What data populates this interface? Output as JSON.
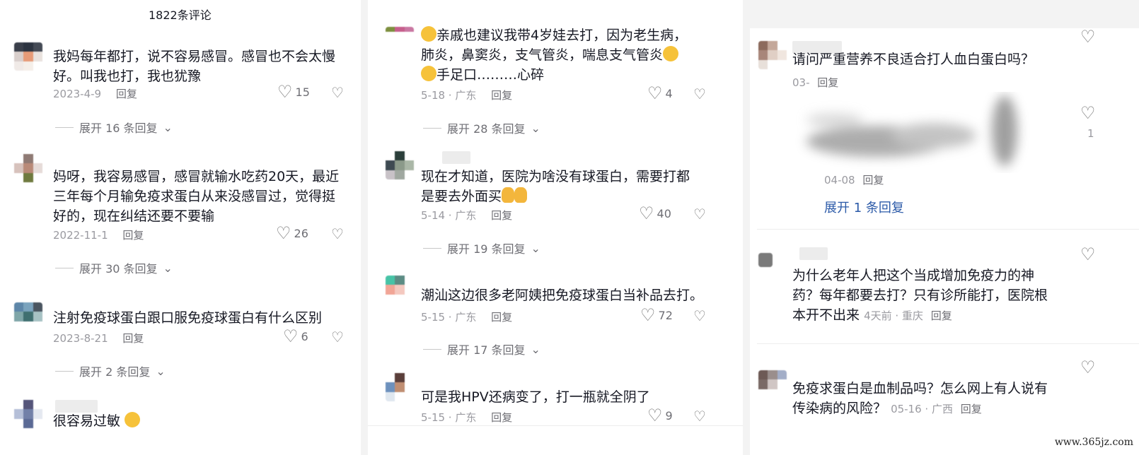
{
  "col1": {
    "header": "1822条评论",
    "comments": [
      {
        "text": "我妈每年都打，说不容易感冒。感冒也不会太慢好。叫我也打，我也犹豫",
        "date": "2023-4-9",
        "reply": "回复",
        "likes": "15",
        "expand": "展开 16 条回复"
      },
      {
        "text": "妈呀，我容易感冒，感冒就输水吃药20天，最近三年每个月输免疫求蛋白从来没感冒过，觉得挺好的，现在纠结还要不要输",
        "date": "2022-11-1",
        "reply": "回复",
        "likes": "26",
        "expand": "展开 30 条回复"
      },
      {
        "text": "注射免疫球蛋白跟口服免疫球蛋白有什么区别",
        "date": "2023-8-21",
        "reply": "回复",
        "likes": "6",
        "expand": "展开 2 条回复"
      },
      {
        "text": "很容易过敏"
      }
    ]
  },
  "col2": {
    "comments": [
      {
        "text_a": "亲戚也建议我带4岁娃去打，因为老生病，",
        "text_b": "肺炎，鼻窦炎，支气管炎，喘息支气管炎",
        "text_c": "手足口………心碎",
        "date": "5-18 · 广东",
        "reply": "回复",
        "likes": "4",
        "expand": "展开 28 条回复"
      },
      {
        "text_a": "现在才知道，医院为啥没有球蛋白，需要打都",
        "text_b": "是要去外面买",
        "date": "5-14 · 广东",
        "reply": "回复",
        "likes": "40",
        "expand": "展开 19 条回复"
      },
      {
        "text": "潮汕这边很多老阿姨把免疫球蛋白当补品去打。",
        "date": "5-15 · 广东",
        "reply": "回复",
        "likes": "72",
        "expand": "展开 17 条回复"
      },
      {
        "text": "可是我HPV还病变了，打一瓶就全阴了",
        "date": "5-15 · 广东",
        "reply": "回复",
        "likes": "9"
      }
    ]
  },
  "col3": {
    "comments": [
      {
        "text": "请问严重营养不良适合打人血白蛋白吗？",
        "date": "03-",
        "reply": "回复",
        "sub_date": "04-08",
        "sub_reply": "回复",
        "sub_likes": "1",
        "expand": "展开 1 条回复"
      },
      {
        "text_a": "为什么老年人把这个当成增加免疫力的神",
        "text_b": "药？每年都要去打？只有诊所能打，医院根",
        "text_c": "本开不出来",
        "date": "4天前 · 重庆",
        "reply": "回复"
      },
      {
        "text_a": "免疫求蛋白是血制品吗？怎么网上有人说有",
        "text_b": "传染病的风险？",
        "date": "05-16 · 广西",
        "reply": "回复"
      }
    ]
  },
  "watermark": "www.365jz.com",
  "colors": {
    "text": "#161823",
    "meta": "#9a9aa0",
    "link_blue": "#2b5aa8",
    "emoji": "#f6c23a"
  },
  "icons": [
    "heart-icon",
    "dislike-icon",
    "chevron-down-icon",
    "emoji-icon",
    "thumbs-up-icon"
  ]
}
